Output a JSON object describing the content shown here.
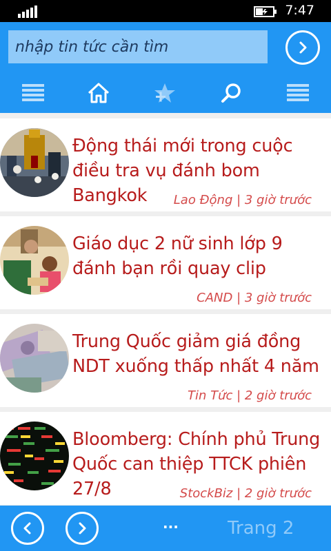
{
  "status_bar": {
    "time": "7:47",
    "signal_icon": "signal-bars-icon",
    "battery_icon": "battery-charging-icon"
  },
  "header": {
    "search": {
      "placeholder": "nhập tin tức cần tìm",
      "value": ""
    },
    "go_icon": "chevron-right-circle-icon",
    "nav": [
      {
        "name": "menu",
        "icon": "hamburger-menu-icon"
      },
      {
        "name": "home",
        "icon": "home-icon"
      },
      {
        "name": "favorites",
        "icon": "star-plus-icon"
      },
      {
        "name": "search",
        "icon": "magnifier-icon"
      },
      {
        "name": "more",
        "icon": "list-lines-icon"
      }
    ]
  },
  "articles": [
    {
      "title": "Động thái mới trong cuộc điều tra vụ đánh bom Bangkok",
      "meta": "Lao Động | 3 giờ trước",
      "thumb_icon": "news-thumbnail-shrine"
    },
    {
      "title": "Giáo dục 2 nữ sinh lớp 9 đánh bạn rồi quay clip",
      "meta": "CAND | 3 giờ trước",
      "thumb_icon": "news-thumbnail-students"
    },
    {
      "title": "Trung Quốc giảm giá đồng NDT xuống thấp nhất 4 năm",
      "meta": "Tin Tức | 2 giờ trước",
      "thumb_icon": "news-thumbnail-banknotes"
    },
    {
      "title": "Bloomberg: Chính phủ Trung Quốc can thiệp TTCK phiên 27/8",
      "meta": "StockBiz | 2 giờ trước",
      "thumb_icon": "news-thumbnail-stock-board"
    }
  ],
  "footer": {
    "prev_icon": "chevron-left-circle-icon",
    "next_icon": "chevron-right-circle-icon",
    "more": "...",
    "page_label": "Trang 2"
  },
  "colors": {
    "accent": "#2196f3",
    "search_field": "#90caf9",
    "headline": "#b71c1c",
    "meta": "#d44a4a",
    "page_label": "#90caf9"
  }
}
